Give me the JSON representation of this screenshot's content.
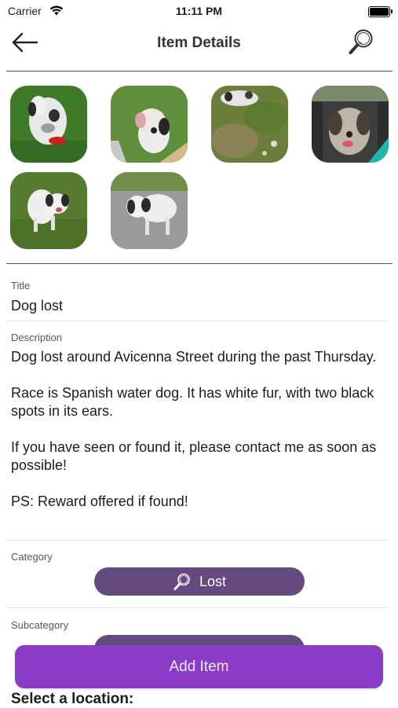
{
  "status_bar": {
    "carrier": "Carrier",
    "time": "11:11 PM",
    "icons": [
      "wifi-icon",
      "battery-icon"
    ]
  },
  "nav": {
    "title": "Item Details",
    "back_icon": "arrow-left-icon",
    "search_icon": "magnifier-icon"
  },
  "photos": [
    {
      "name": "dog-on-grass-with-red-toy"
    },
    {
      "name": "dog-on-grass-near-bench"
    },
    {
      "name": "dog-rolling-on-grass"
    },
    {
      "name": "dog-in-car-seat"
    },
    {
      "name": "dog-standing-on-grass"
    },
    {
      "name": "dog-on-pavement"
    }
  ],
  "form": {
    "title_label": "Title",
    "title_value": "Dog lost",
    "description_label": "Description",
    "description_value": "Dog lost around Avicenna Street during the past Thursday.\n\nRace is Spanish water dog. It has white fur, with two black spots in its ears.\n\nIf you have seen or found it, please contact me as soon as possible!\n\nPS: Reward offered if found!",
    "category_label": "Category",
    "category_value": "Lost",
    "category_icon": "magnifier-icon",
    "subcategory_label": "Subcategory"
  },
  "add_item_label": "Add Item",
  "location_label": "Select a location:",
  "colors": {
    "pill": "#654a7f",
    "add_button": "#8a3bc8"
  }
}
